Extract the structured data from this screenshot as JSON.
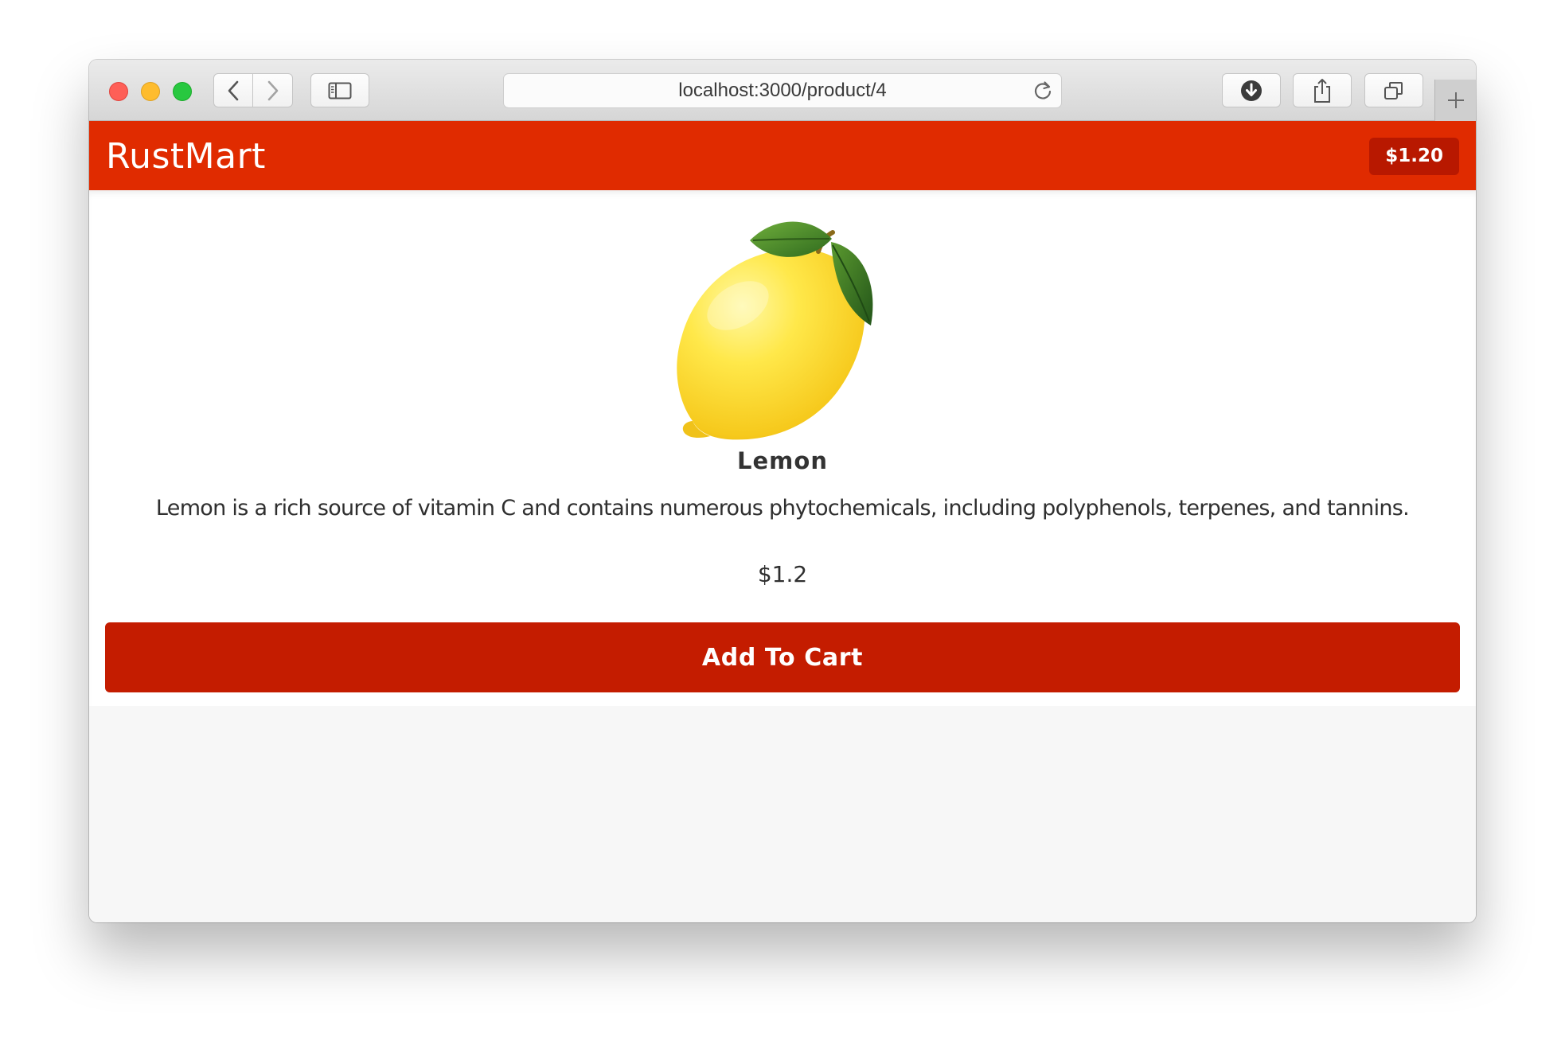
{
  "browser": {
    "url": "localhost:3000/product/4"
  },
  "navbar": {
    "brand": "RustMart",
    "cart_total": "$1.20"
  },
  "product": {
    "image_icon": "lemon-image",
    "name": "Lemon",
    "description": "Lemon is a rich source of vitamin C and contains numerous phytochemicals, including polyphenols, terpenes, and tannins.",
    "price": "$1.2",
    "add_to_cart_label": "Add To Cart"
  },
  "colors": {
    "navbar": "#e02b00",
    "cart_badge": "#b81800",
    "button": "#c41c00"
  }
}
